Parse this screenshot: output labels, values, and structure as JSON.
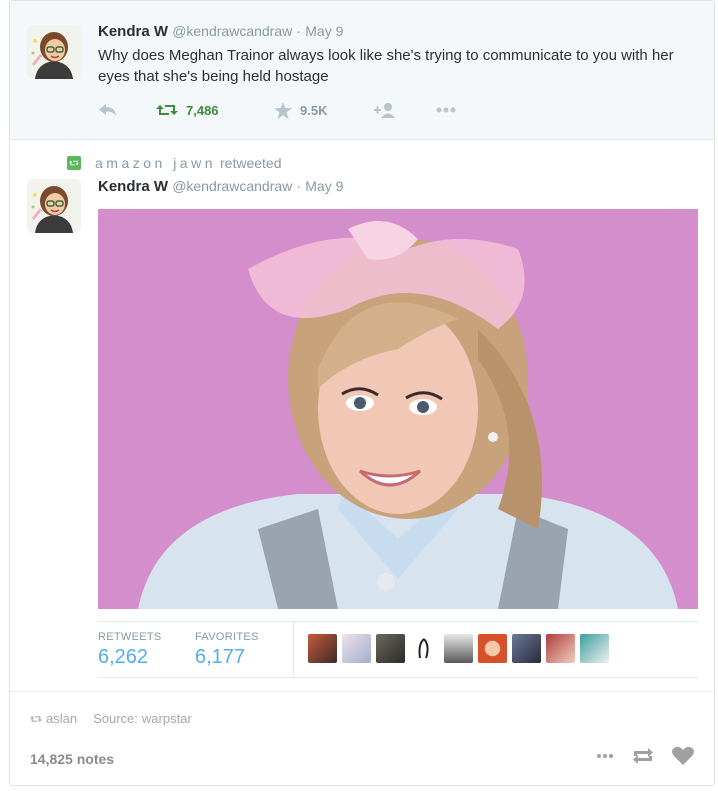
{
  "tweet": {
    "display_name": "Kendra W",
    "handle": "@kendrawcandraw",
    "date": "May 9",
    "text": "Why does Meghan Trainor always look like she's trying to communicate to you with her eyes that she's being held hostage",
    "retweet_count": "7,486",
    "favorite_count": "9.5K"
  },
  "retweet": {
    "retweeter": "amazon jawn",
    "retweeted_word": "retweeted",
    "display_name": "Kendra W",
    "handle": "@kendrawcandraw",
    "date": "May 9"
  },
  "stats": {
    "retweets_label": "RETWEETS",
    "retweets_value": "6,262",
    "favorites_label": "FAVORITES",
    "favorites_value": "6,177"
  },
  "footer": {
    "reblogged_from": "aslan",
    "source_label": "Source:",
    "source_name": "warpstar",
    "notes": "14,825 notes"
  },
  "colors": {
    "retweet_green": "#3a8c3a",
    "stat_blue": "#55acee",
    "photo_bg": "#d38ecb"
  },
  "icons": [
    "reply-icon",
    "retweet-icon",
    "star-icon",
    "follow-icon",
    "more-icon",
    "reblog-icon",
    "like-icon"
  ]
}
